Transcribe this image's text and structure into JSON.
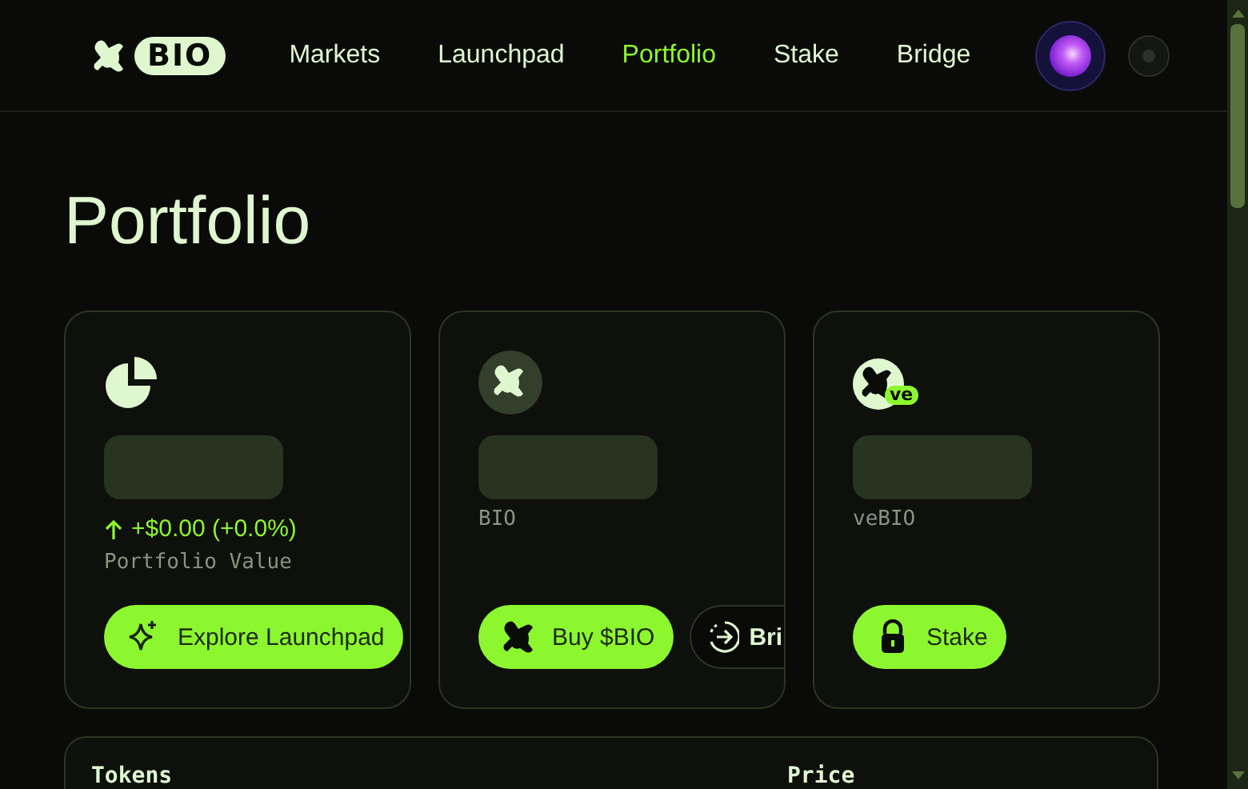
{
  "logo": {
    "text": "BIO"
  },
  "nav": {
    "items": [
      {
        "label": "Markets",
        "selected": false
      },
      {
        "label": "Launchpad",
        "selected": false
      },
      {
        "label": "Portfolio",
        "selected": true
      },
      {
        "label": "Stake",
        "selected": false
      },
      {
        "label": "Bridge",
        "selected": false
      }
    ]
  },
  "page_title": "Portfolio",
  "cards": [
    {
      "change": "+$0.00 (+0.0%)",
      "label": "Portfolio Value",
      "buttons": [
        {
          "label": "Explore Launchpad",
          "kind": "primary"
        }
      ]
    },
    {
      "label": "BIO",
      "buttons": [
        {
          "label": "Buy $BIO",
          "kind": "primary"
        },
        {
          "label": "Bri",
          "kind": "secondary"
        }
      ]
    },
    {
      "badge": "ve",
      "label": "veBIO",
      "buttons": [
        {
          "label": "Stake",
          "kind": "primary"
        }
      ]
    }
  ],
  "table": {
    "columns": [
      "Tokens",
      "Price"
    ]
  }
}
